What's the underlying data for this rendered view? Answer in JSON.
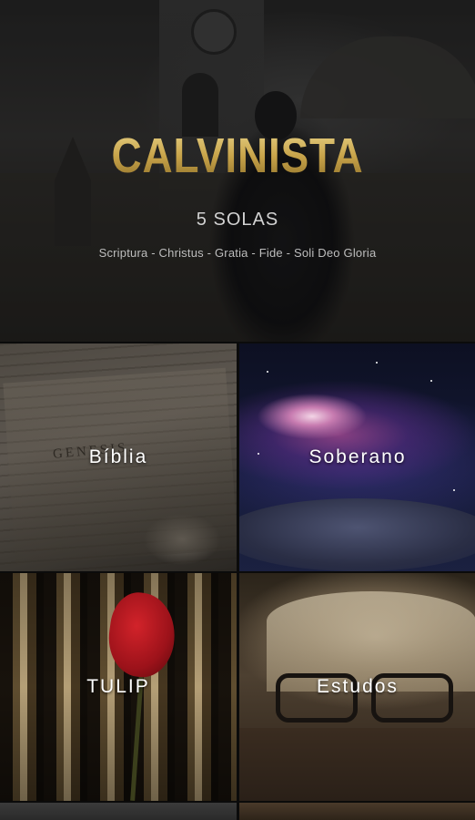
{
  "header": {
    "title": "CALVINISTA",
    "subtitle": "5 SOLAS",
    "tagline": "Scriptura - Christus - Gratia - Fide - Soli Deo Gloria"
  },
  "menu": {
    "items": [
      {
        "label": "Bíblia"
      },
      {
        "label": "Soberano"
      },
      {
        "label": "TULIP"
      },
      {
        "label": "Estudos"
      }
    ]
  },
  "colors": {
    "title_gold": "#c9a94d",
    "label_text": "#ffffff",
    "background": "#0b0b0b"
  }
}
